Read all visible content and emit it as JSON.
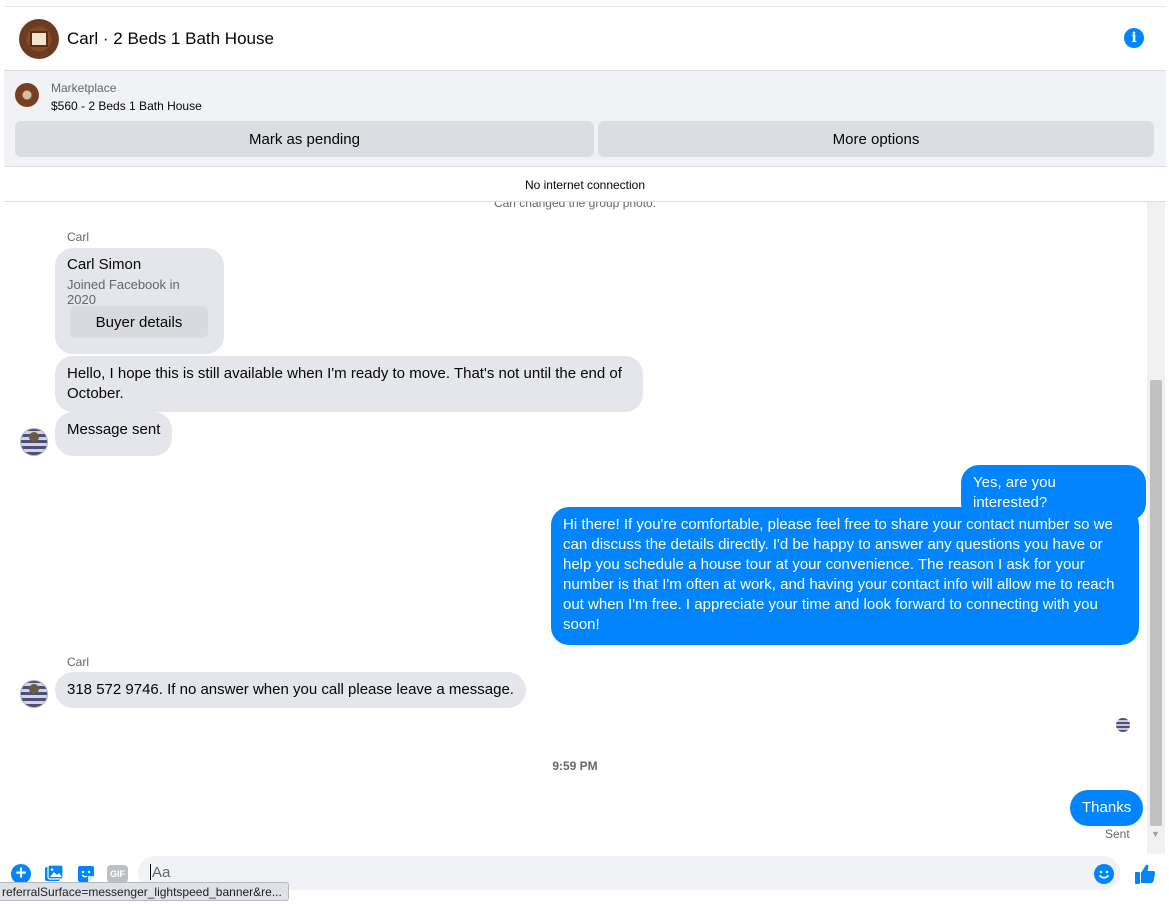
{
  "header": {
    "title": "Carl · 2 Beds 1 Bath House",
    "info_icon": "info-icon"
  },
  "marketplace": {
    "label": "Marketplace",
    "listing": "$560 - 2 Beds 1 Bath House",
    "mark_pending_label": "Mark as pending",
    "more_options_label": "More options"
  },
  "status_notice": "No internet connection",
  "chat": {
    "system_message": "Carl changed the group photo.",
    "buyer_card": {
      "sender": "Carl",
      "name": "Carl Simon",
      "joined": "Joined Facebook in 2020",
      "button_label": "Buyer details"
    },
    "messages": [
      {
        "from": "them",
        "text": "Hello, I hope this is still available when I'm ready to move. That's not until the end of October."
      },
      {
        "from": "them",
        "text": "Message sent"
      },
      {
        "from": "me",
        "text": "Yes, are you interested?"
      },
      {
        "from": "me",
        "text": "Hi there! If you're comfortable, please feel free to share your contact number so we can discuss the details directly. I'd be happy to answer any questions you have or help you schedule a house tour at your convenience. The reason I ask for your number is that I'm often at work, and having your contact info will allow me to reach out when I'm free. I appreciate your time and look forward to connecting with you soon!"
      },
      {
        "from": "them",
        "sender": "Carl",
        "text": "318 572 9746. If no answer when you call please leave a message."
      },
      {
        "from": "me",
        "text": "Thanks"
      }
    ],
    "timestamp": "9:59 PM",
    "sent_status": "Sent"
  },
  "composer": {
    "placeholder": "Aa",
    "icons": [
      "plus-icon",
      "photo-icon",
      "sticker-icon",
      "gif-icon",
      "emoji-icon",
      "thumbs-up-icon"
    ],
    "gif_label": "GIF"
  },
  "status_bar_url": "referralSurface=messenger_lightspeed_banner&re...",
  "colors": {
    "accent": "#0084ff",
    "incoming_bubble": "#e4e6eb",
    "panel_bg": "#f0f2f5",
    "secondary_text": "#65676b"
  }
}
